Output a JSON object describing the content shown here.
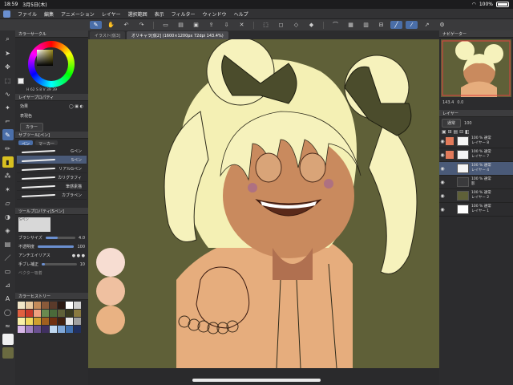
{
  "status": {
    "time": "18:59",
    "date": "3月5日(木)",
    "battery": "100%"
  },
  "menu": [
    "ファイル",
    "編集",
    "アニメーション",
    "レイヤー",
    "選択範囲",
    "表示",
    "フィルター",
    "ウィンドウ",
    "ヘルプ"
  ],
  "doc_tabs": [
    "イラスト(仮3]",
    "オリキャラ[仮2] (1600×1200px 72dpi 143.4%)"
  ],
  "left_panel": {
    "color_circle_title": "カラーサークル",
    "color_values": "H 62  S 8  V 39  39",
    "layer_prop_title": "レイヤープロパティ",
    "effect_label": "効果",
    "expression_label": "表現色",
    "expression_value": "カラー",
    "subtool_title": "サブツール[ペン]",
    "subtool_tabs": [
      "ペン",
      "マーカー"
    ],
    "brushes": [
      "Gペン",
      "Sペン",
      "リアルGペン",
      "カリグラフィ",
      "筆感素描",
      "カブラペン"
    ],
    "tool_prop_title": "ツールプロパティ[Sペン]",
    "brush_name": "Sペン",
    "brush_size_label": "ブラシサイズ",
    "brush_size_value": "4.0",
    "opacity_label": "不透明度",
    "opacity_value": "100",
    "antialias_label": "アンチエイリアス",
    "stabilize_label": "手ブレ補正",
    "stabilize_value": "10",
    "vector_label": "ベクター吸着",
    "history_title": "カラーヒストリー"
  },
  "right_panel": {
    "navigator_title": "ナビゲーター",
    "zoom": "143.4",
    "rotation": "0.0",
    "layer_title": "レイヤー",
    "blend_mode": "通常",
    "opacity": "100",
    "layers": [
      {
        "pct": "100 %",
        "mode": "通常",
        "name": "レイヤー 8",
        "active": false,
        "thumb": "#f5f5f5"
      },
      {
        "pct": "100 %",
        "mode": "通常",
        "name": "レイヤー 7",
        "active": false,
        "thumb": "#f5f5f5"
      },
      {
        "pct": "100 %",
        "mode": "通常",
        "name": "レイヤー 4",
        "active": true,
        "thumb": "#f5f5f5"
      },
      {
        "pct": "100 %",
        "mode": "通常",
        "name": "影",
        "active": false,
        "thumb": "#3a3a3c"
      },
      {
        "pct": "100 %",
        "mode": "通常",
        "name": "レイヤー 2",
        "active": false,
        "thumb": "#5f6038"
      },
      {
        "pct": "100 %",
        "mode": "通常",
        "name": "レイヤー 1",
        "active": false,
        "thumb": "#ffffff"
      }
    ]
  },
  "history_colors": [
    "#f2e6c8",
    "#e8c9a0",
    "#c48a5a",
    "#8a5a3a",
    "#5a3a2a",
    "#2a1a14",
    "#ffffff",
    "#d0d0d0",
    "#e06040",
    "#c83a2a",
    "#f0a080",
    "#6a8a50",
    "#4a6a3a",
    "#5f6038",
    "#3a3a20",
    "#8a7a40",
    "#f8f0a8",
    "#f0d860",
    "#d0a030",
    "#a06020",
    "#703010",
    "#402010",
    "#e8e8e8",
    "#a0a0a0",
    "#d8b8e8",
    "#a080c0",
    "#6a5090",
    "#403060",
    "#c0d8f0",
    "#80a8d8",
    "#4070b0",
    "#203060"
  ],
  "palette_swatches": [
    "#f7ddd2",
    "#efc0a0",
    "#e9b283",
    "#e0a068"
  ]
}
